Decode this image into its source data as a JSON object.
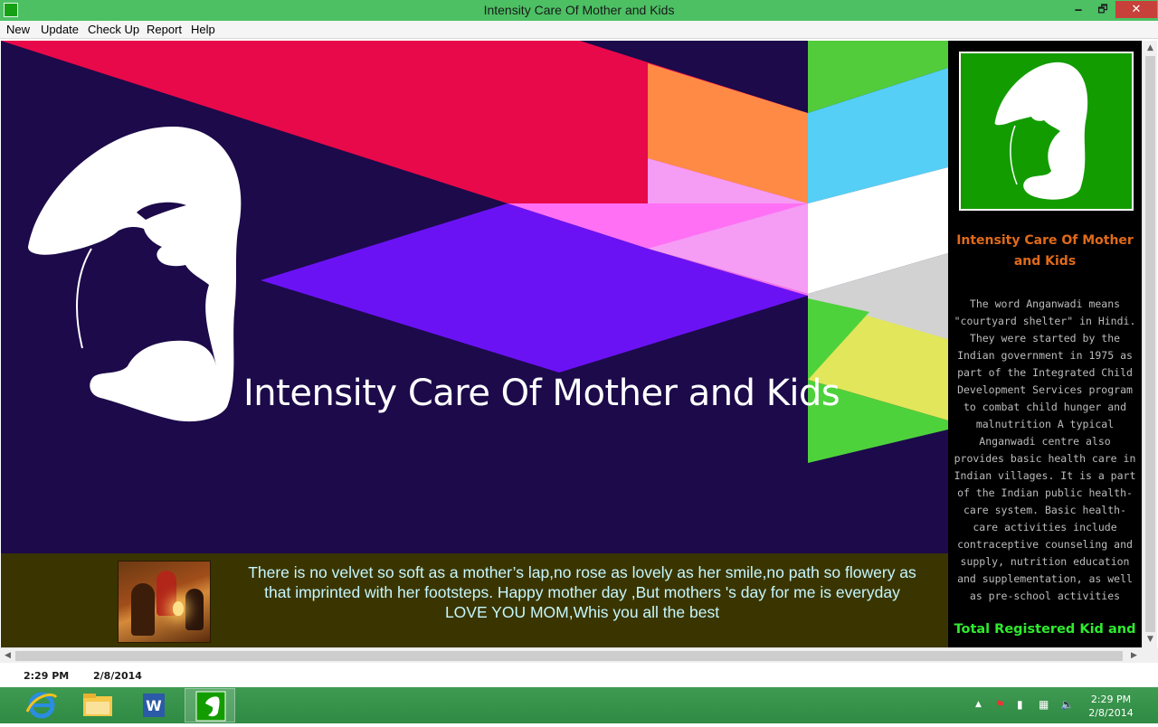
{
  "window": {
    "title": "Intensity Care Of Mother and Kids",
    "minimize_glyph": "🗕",
    "maximize_glyph": "🗗",
    "close_glyph": "✕"
  },
  "menu": {
    "items": [
      "New",
      "Update",
      "Check Up",
      "Report",
      "Help"
    ]
  },
  "banner": {
    "title": "Intensity Care Of Mother and Kids"
  },
  "quote": {
    "text": "There is no velvet so soft as a mother’s lap,no rose as lovely as her smile,no path so flowery as that imprinted with her footsteps. Happy mother day ,But mothers 's day for me is everyday LOVE YOU MOM,Whis you all the best"
  },
  "side_panel": {
    "heading": "Intensity Care Of Mother and Kids",
    "description": "The word Anganwadi means \"courtyard shelter\" in Hindi. They were started by the Indian government in 1975 as part of the Integrated Child Development Services program to combat child hunger and malnutrition A typical Anganwadi centre also provides basic health care in Indian villages. It is a part of the Indian public health-care system. Basic health-care activities include contraceptive counseling and supply, nutrition education and supplementation, as well as pre-school activities",
    "total_label": "Total Registered Kid and"
  },
  "status": {
    "time": "2:29 PM",
    "date": "2/8/2014"
  },
  "taskbar": {
    "clock_time": "2:29 PM",
    "clock_date": "2/8/2014",
    "apps": [
      "internet-explorer-icon",
      "file-explorer-icon",
      "word-icon",
      "anganwadi-app-icon"
    ]
  },
  "colors": {
    "titlebar": "#4cc063",
    "banner_bg": "#1c0a4a",
    "side_heading": "#e06a1a",
    "total_label": "#2eeb2e",
    "quote_text": "#c6f7ff"
  }
}
